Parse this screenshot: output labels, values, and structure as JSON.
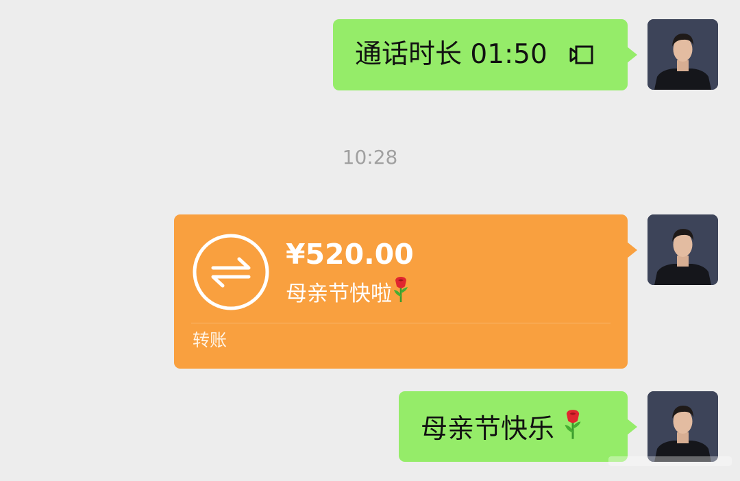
{
  "messages": {
    "call": {
      "text": "通话时长 01:50",
      "icon": "video-call-icon"
    },
    "timestamp": "10:28",
    "transfer": {
      "amount": "¥520.00",
      "remark": "母亲节快啦",
      "label": "转账",
      "icon": "transfer-arrows-icon",
      "emoji": "rose"
    },
    "wish": {
      "text": "母亲节快乐",
      "emoji": "rose"
    }
  },
  "colors": {
    "background": "#ededed",
    "sent_bubble": "#95ec69",
    "transfer_bubble": "#f9a03f",
    "timestamp_text": "#a0a0a0"
  }
}
